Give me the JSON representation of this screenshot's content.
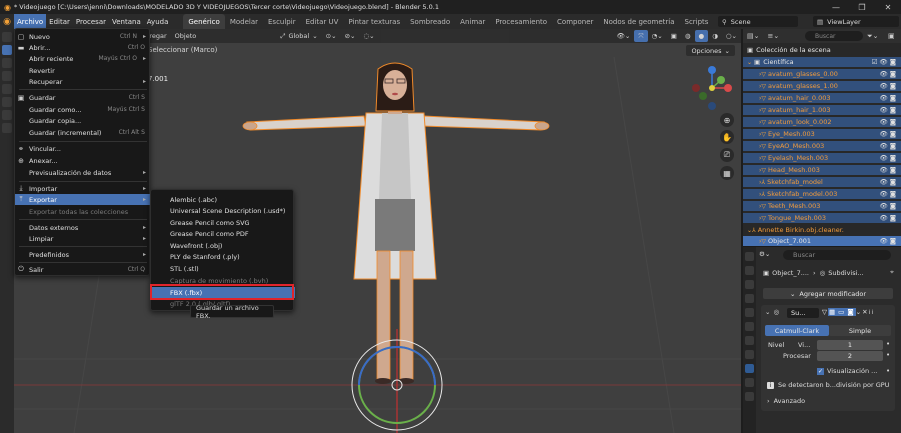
{
  "window": {
    "title": "* Videojuego [C:\\Users\\jenni\\Downloads\\MODELADO 3D Y VIDEOJUEGOS\\Tercer corte\\Videojuego\\Videojuego.blend] - Blender 5.0.1",
    "controls": [
      "—",
      "❐",
      "✕"
    ]
  },
  "menu": {
    "items": [
      "Archivo",
      "Editar",
      "Procesar",
      "Ventana",
      "Ayuda"
    ],
    "workspaces": [
      "Genérico",
      "Modelar",
      "Esculpir",
      "Editar UV",
      "Pintar texturas",
      "Sombreado",
      "Animar",
      "Procesamiento",
      "Componer",
      "Nodos de geometría",
      "Scripts"
    ],
    "add_tab": "+",
    "scene": "Scene",
    "view_layer": "ViewLayer"
  },
  "viewport": {
    "header": {
      "view": "Vista",
      "select_box": "Seleccionar (Marco)",
      "menu_select": "nar",
      "menu_add": "Agregar",
      "menu_object": "Objeto",
      "orientation": "Global",
      "options": "Opciones"
    },
    "partial_label": "7.001",
    "side_label": "Or"
  },
  "file_menu": {
    "items": [
      {
        "icon": "▢",
        "label": "Nuevo",
        "shortcut": "Ctrl N",
        "arrow": "▸"
      },
      {
        "icon": "▬",
        "label": "Abrir...",
        "shortcut": "Ctrl O",
        "arrow": ""
      },
      {
        "icon": "",
        "label": "Abrir reciente",
        "shortcut": "Mayús Ctrl O",
        "arrow": "▸"
      },
      {
        "icon": "",
        "label": "Revertir",
        "shortcut": "",
        "arrow": ""
      },
      {
        "icon": "",
        "label": "Recuperar",
        "shortcut": "",
        "arrow": "▸"
      },
      {
        "icon": "▣",
        "label": "Guardar",
        "shortcut": "Ctrl S",
        "arrow": ""
      },
      {
        "icon": "",
        "label": "Guardar como...",
        "shortcut": "Mayús Ctrl S",
        "arrow": ""
      },
      {
        "icon": "",
        "label": "Guardar copia...",
        "shortcut": "",
        "arrow": ""
      },
      {
        "icon": "",
        "label": "Guardar (incremental)",
        "shortcut": "Ctrl Alt S",
        "arrow": ""
      },
      {
        "icon": "⚭",
        "label": "Vincular...",
        "shortcut": "",
        "arrow": ""
      },
      {
        "icon": "⊕",
        "label": "Anexar...",
        "shortcut": "",
        "arrow": ""
      },
      {
        "icon": "",
        "label": "Previsualización de datos",
        "shortcut": "",
        "arrow": "▸"
      },
      {
        "icon": "⤓",
        "label": "Importar",
        "shortcut": "",
        "arrow": "▸"
      },
      {
        "icon": "⤒",
        "label": "Exportar",
        "shortcut": "",
        "arrow": "▸"
      },
      {
        "icon": "",
        "label": "Exportar todas las colecciones",
        "shortcut": "",
        "arrow": ""
      },
      {
        "icon": "",
        "label": "Datos externos",
        "shortcut": "",
        "arrow": "▸"
      },
      {
        "icon": "",
        "label": "Limpiar",
        "shortcut": "",
        "arrow": "▸"
      },
      {
        "icon": "",
        "label": "Predefinidos",
        "shortcut": "",
        "arrow": "▸"
      },
      {
        "icon": "⏻",
        "label": "Salir",
        "shortcut": "Ctrl Q",
        "arrow": ""
      }
    ]
  },
  "export_menu": {
    "items": [
      "Alembic (.abc)",
      "Universal Scene Description (.usd*)",
      "Grease Pencil como SVG",
      "Grease Pencil como PDF",
      "Wavefront (.obj)",
      "PLY de Stanford (.ply)",
      "STL (.stl)",
      "Captura de movimiento (.bvh)",
      "FBX (.fbx)",
      "glTF 2.0 (.glb/.gltf)"
    ],
    "tooltip": "Guardar un archivo FBX."
  },
  "outliner": {
    "search_placeholder": "Buscar",
    "root": "Colección de la escena",
    "collection": "Científica",
    "rows": [
      "avatum_glasses_0.00",
      "avatum_glasses_1.00",
      "avatum_hair_0.003",
      "avatum_hair_1.003",
      "avatum_look_0.002",
      "Eye_Mesh.003",
      "EyeAO_Mesh.003",
      "Eyelash_Mesh.003",
      "Head_Mesh.003",
      "Sketchfab_model",
      "Sketchfab_model.003",
      "Teeth_Mesh.003",
      "Tongue_Mesh.003"
    ],
    "collection2": "Annette Birkin.obj.cleaner.",
    "active_object": "Object_7.001"
  },
  "properties": {
    "search_placeholder": "Buscar",
    "breadcrumb_object": "Object_7....",
    "breadcrumb_modifier": "Subdivisi...",
    "add_modifier": "Agregar modificador",
    "modifier_name": "Su...",
    "subdiv_type_a": "Catmull-Clark",
    "subdiv_type_b": "Simple",
    "nivel_label": "Nivel",
    "viewport_label": "Vi...",
    "viewport_value": "1",
    "render_label": "Procesar",
    "render_value": "2",
    "visualizacion": "Visualización ...",
    "info": "Se detectaron b...división por GPU",
    "avanzado": "Avanzado"
  }
}
